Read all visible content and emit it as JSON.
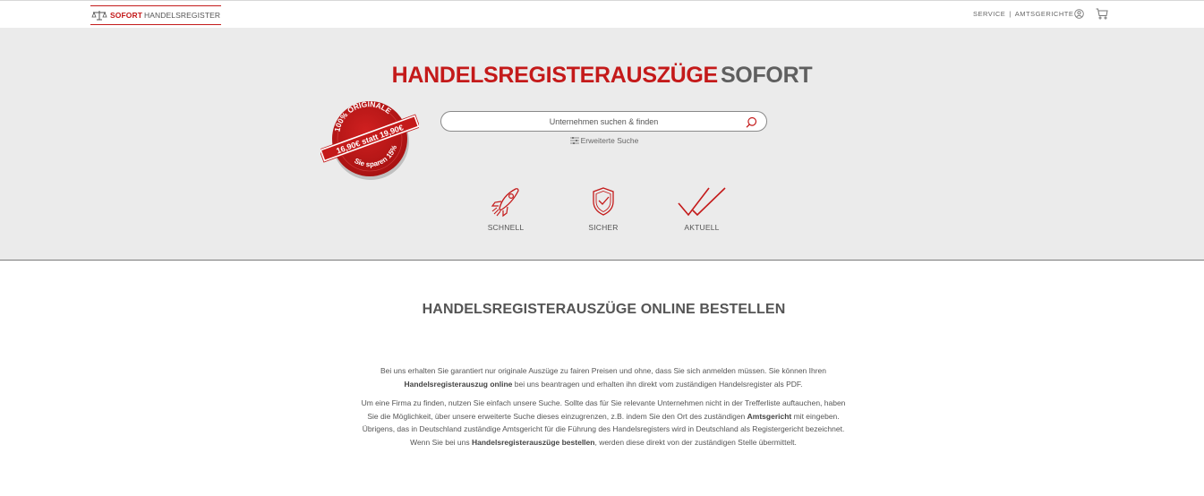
{
  "header": {
    "logo_red": "SOFORT",
    "logo_grey": "HANDELSREGISTER",
    "nav": [
      "SERVICE",
      "AMTSGERICHTE"
    ],
    "nav_separator": "|"
  },
  "hero": {
    "title_red": "HANDELSREGISTERAUSZÜGE",
    "title_grey": "SOFORT",
    "badge": {
      "top_text": "100% ORIGINALE",
      "price_text": "16,90€ statt 19,90€",
      "bottom_text": "Sie sparen 15%"
    },
    "search": {
      "placeholder": "Unternehmen suchen & finden"
    },
    "advanced_search": "Erweiterte Suche",
    "features": [
      {
        "label": "SCHNELL",
        "icon": "rocket-icon"
      },
      {
        "label": "SICHER",
        "icon": "shield-check-icon"
      },
      {
        "label": "AKTUELL",
        "icon": "double-check-icon"
      }
    ]
  },
  "content": {
    "title": "HANDELSREGISTERAUSZÜGE ONLINE BESTELLEN",
    "p1_a": "Bei uns erhalten Sie garantiert nur originale Auszüge zu fairen Preisen und ohne, dass Sie sich anmelden müssen. Sie können Ihren ",
    "p1_b": "Handelsregisterauszug online",
    "p1_c": " bei uns beantragen und erhalten ihn direkt vom zuständigen Handelsregister als PDF.",
    "p2_a": "Um eine Firma zu finden, nutzen Sie einfach unsere Suche. Sollte das für Sie relevante Unternehmen nicht in der Trefferliste auftauchen, haben Sie die Möglichkeit, über unsere erweiterte Suche dieses einzugrenzen, z.B. indem Sie den Ort des zuständigen ",
    "p2_b": "Amtsgericht",
    "p2_c": " mit eingeben. Übrigens, das in Deutschland zuständige Amtsgericht für die Führung des Handelsregisters wird in Deutschland als Registergericht bezeichnet. Wenn Sie bei uns ",
    "p2_d": "Handelsregisterauszüge bestellen",
    "p2_e": ", werden diese direkt von der zuständigen Stelle übermittelt."
  },
  "colors": {
    "accent": "#c41a1a",
    "hero_bg": "#ebebeb",
    "text": "#555555"
  }
}
